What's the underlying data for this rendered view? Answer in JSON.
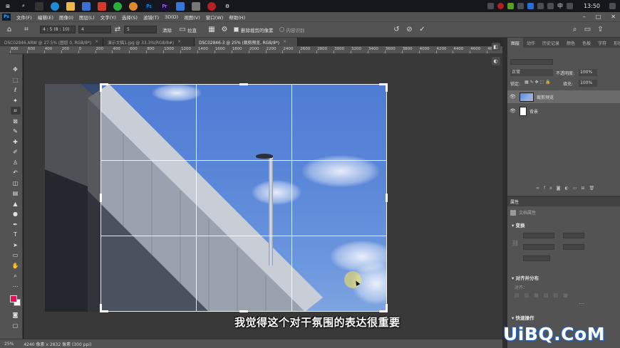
{
  "taskbar": {
    "clock": "13:50",
    "language": "中"
  },
  "menubar": {
    "app_logo": "Ps",
    "items": [
      "文件(F)",
      "编辑(E)",
      "图像(I)",
      "图层(L)",
      "文字(Y)",
      "选择(S)",
      "滤镜(T)",
      "3D(D)",
      "视图(V)",
      "窗口(W)",
      "帮助(H)"
    ]
  },
  "options": {
    "ratio_preset": "4 : 5 (8 : 10)",
    "width": "4",
    "height": "5",
    "clear_label": "清除",
    "straighten_label": "拉直",
    "delete_pixels_label": "删除裁剪的像素",
    "content_aware_label": "内容识别"
  },
  "tabs": [
    {
      "label": "DSC02846.ARW @ 27.5% (图层 0, RGB/8*)",
      "active": false
    },
    {
      "label": "演示文稿1.jpg @ 33.3%(RGB/8#)",
      "active": false
    },
    {
      "label": "DSC02846-3 @ 25% (裁剪预览, RGB/8*)",
      "active": true
    }
  ],
  "ruler": {
    "labels": [
      "800",
      "600",
      "400",
      "200",
      "0",
      "200",
      "400",
      "600",
      "800",
      "1000",
      "1200",
      "1400",
      "1600",
      "1800",
      "2000",
      "2200",
      "2400",
      "2600",
      "2800",
      "3000",
      "3200",
      "3400",
      "3600",
      "3800",
      "4000",
      "4200",
      "4400",
      "4600",
      "4800"
    ]
  },
  "canvas": {
    "subtitle": "我觉得这个对干氛围的表达很重要"
  },
  "status": {
    "zoom": "25%",
    "doc_info": "4240 像素 x 2832 像素 (300 ppi)"
  },
  "layers_panel": {
    "tabs": [
      "图层",
      "动作",
      "历史记录",
      "颜色",
      "色板",
      "字符",
      "形状"
    ],
    "blend_mode": "正常",
    "opacity_label": "不透明度:",
    "opacity_value": "100%",
    "lock_label": "锁定:",
    "fill_label": "填充:",
    "fill_value": "100%",
    "layers": [
      {
        "name": "裁剪预览",
        "selected": true
      },
      {
        "name": "背景",
        "selected": false
      }
    ]
  },
  "properties_panel": {
    "title": "属性",
    "doc_label": "文档属性",
    "transform_label": "变换",
    "align_label": "对齐并分布",
    "align_sub": "对齐：",
    "quick_actions_label": "快速操作"
  },
  "colors": {
    "accent": "#31a8ff",
    "foreground_swatch": "#e0145a",
    "background_swatch": "#ffffff"
  },
  "watermark": "UiBQ.CoM"
}
